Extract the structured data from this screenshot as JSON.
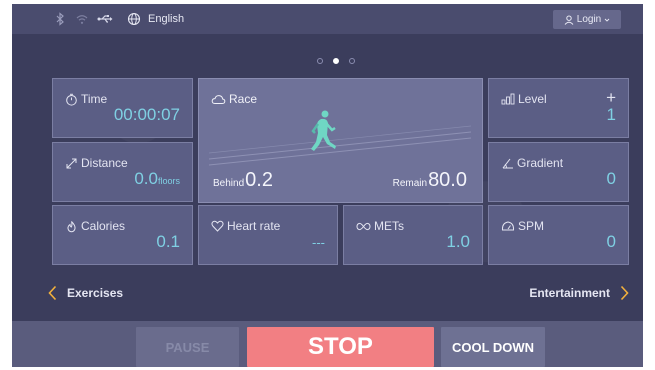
{
  "topbar": {
    "language": "English",
    "login_label": "Login",
    "icons": [
      "bluetooth-icon",
      "wifi-icon",
      "usb-icon",
      "globe-icon",
      "user-icon",
      "chevron-down-icon"
    ]
  },
  "pager": {
    "pages": 3,
    "active": 2
  },
  "cards": {
    "time": {
      "label": "Time",
      "value": "00:00:07"
    },
    "distance": {
      "label": "Distance",
      "value": "0.0",
      "unit": "floors"
    },
    "calories": {
      "label": "Calories",
      "value": "0.1"
    },
    "heart_rate": {
      "label": "Heart rate",
      "value": "---"
    },
    "mets": {
      "label": "METs",
      "value": "1.0"
    },
    "level": {
      "label": "Level",
      "value": "1",
      "plus": "+"
    },
    "gradient": {
      "label": "Gradient",
      "value": "0"
    },
    "spm": {
      "label": "SPM",
      "value": "0"
    }
  },
  "race": {
    "label": "Race",
    "behind_label": "Behind",
    "behind_value": "0.2",
    "remain_label": "Remain",
    "remain_value": "80.0"
  },
  "nav": {
    "left": "Exercises",
    "right": "Entertainment"
  },
  "buttons": {
    "pause": "PAUSE",
    "stop": "STOP",
    "cool_down": "COOL DOWN"
  },
  "colors": {
    "background": "#3b3d5c",
    "card": "#5b5e85",
    "race_card": "#6f7299",
    "value_accent": "#7fd0e3",
    "stop": "#f27f83",
    "runner": "#6fd7c4",
    "chevron": "#f2b13c"
  }
}
